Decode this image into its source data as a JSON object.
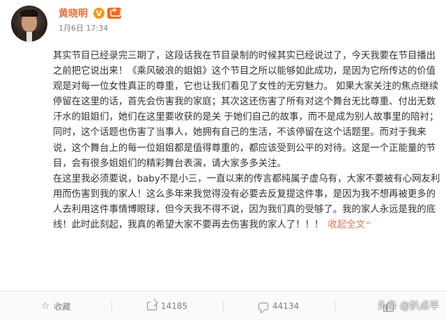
{
  "post": {
    "author": "黄晓明",
    "verified_badge": "V",
    "timestamp": "1月6日 17:34",
    "paragraphs": [
      "其实节目已经录完三期了，这段话我在节目录制的时候其实已经说过了，今天我要在节目播出之前把它说出来！《乘风破浪的姐姐》这个节目之所以能够如此成功，是因为它所传达的价值观是对每一位女性真正的尊重，它也让我们看见了女性的无穷魅力。 如果大家关注的焦点继续停留在这里的话，首先会伤害我的家庭；其次这还伤害了所有对这个舞台无比尊重、付出无数汗水的姐姐们，她们在这里要收获的是关 于她们自己的故事，而不是成为别人故事里的陪衬；同时，这个话题也伤害了当事人，她拥有自己的生活，不该停留在这个话题里。而对于我来说，这个舞台上的每一位姐姐都是值得尊重的，都应该受到公平的对待。这是一个正能量的节目，会有很多姐姐们的精彩舞台表演，请大家多多关注。",
      "在这里我必须要说，baby不是小三，一直以来的传言都纯属子虚乌有，大家不要被有心网友利用而伤害到我的家人！这么多年来我觉得没有必要去反复提这件事，是因为我不想再被更多的人去利用这件事情博眼球，但今天我不得不说，因为我们真的受够了。我的家人永远是我的底线！此时此刻起，我真的希望大家不要再去伤害我的家人了！！！"
    ],
    "collapse_label": "收起全文",
    "collapse_icon": "^"
  },
  "footer": {
    "favorite_label": "收藏",
    "repost_count": "14185",
    "comment_count": "44134"
  },
  "watermark": "头条 @扒点半",
  "icons": {
    "favorite": "star-icon",
    "repost": "share-icon",
    "comment": "comment-icon",
    "like": "thumbs-up-icon"
  },
  "colors": {
    "author_name": "#ea6f3a",
    "link": "#eb7350",
    "verified_badge": "#f29b1b",
    "text": "#333333",
    "meta": "#808080"
  }
}
